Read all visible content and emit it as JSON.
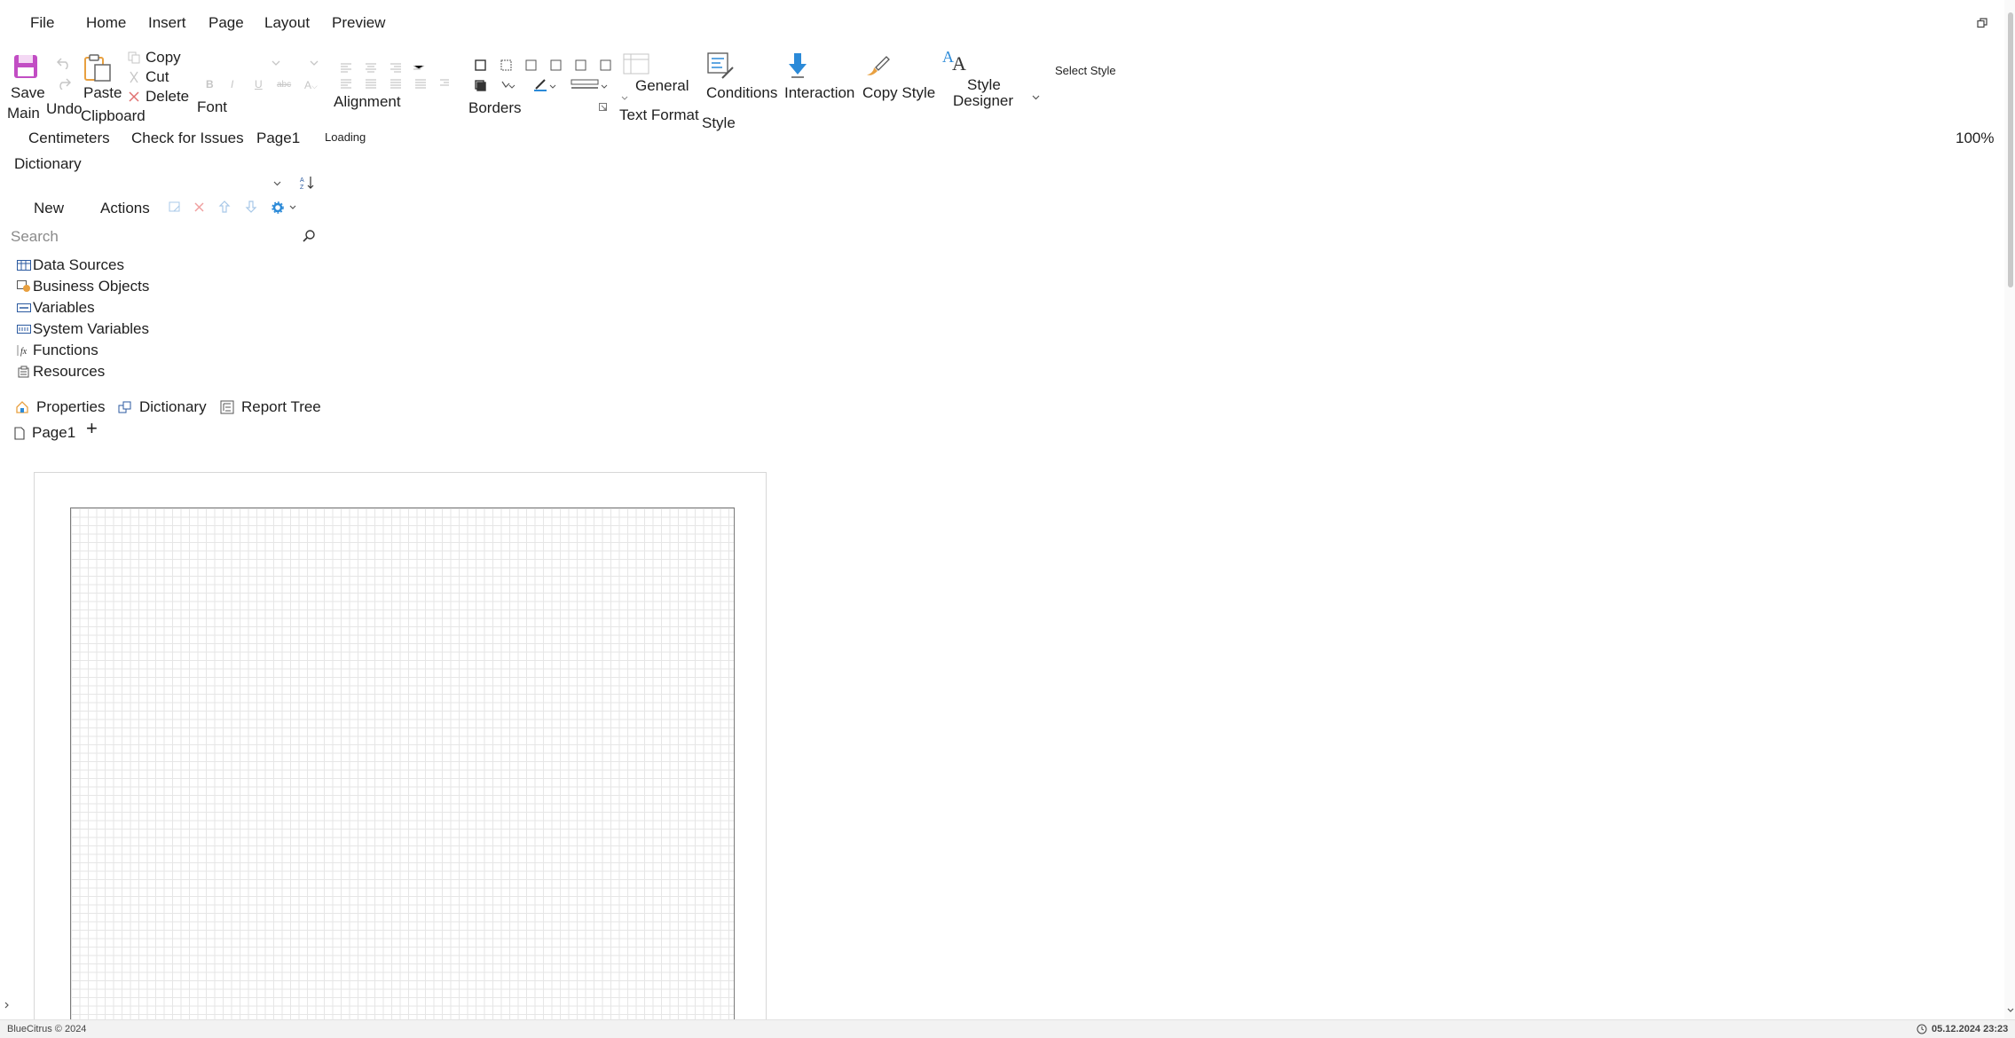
{
  "menu": {
    "file": "File",
    "home": "Home",
    "insert": "Insert",
    "page": "Page",
    "layout": "Layout",
    "preview": "Preview"
  },
  "ribbon": {
    "save_label_1": "Save",
    "save_label_2": "Main",
    "undo_label": "Undo",
    "paste_label": "Paste",
    "copy_label": "Copy",
    "cut_label": "Cut",
    "delete_label": "Delete",
    "clipboard_group": "Clipboard",
    "font_group": "Font",
    "alignment_group": "Alignment",
    "borders_group": "Borders",
    "general_label": "General",
    "text_format_group": "Text Format",
    "conditions_label": "Conditions",
    "interaction_label": "Interaction",
    "copy_style_label": "Copy Style",
    "style_designer_1": "Style",
    "style_designer_2": "Designer",
    "select_style_label": "Select Style",
    "style_group": "Style"
  },
  "subbar": {
    "units": "Centimeters",
    "check_issues": "Check for Issues",
    "page": "Page1",
    "loading": "Loading",
    "zoom": "100%"
  },
  "dictionary": {
    "title": "Dictionary",
    "new_label": "New",
    "actions_label": "Actions",
    "search_placeholder": "Search",
    "items": [
      {
        "label": "Data Sources",
        "icon": "data-sources-icon"
      },
      {
        "label": "Business Objects",
        "icon": "business-objects-icon"
      },
      {
        "label": "Variables",
        "icon": "variables-icon"
      },
      {
        "label": "System Variables",
        "icon": "system-variables-icon"
      },
      {
        "label": "Functions",
        "icon": "functions-icon"
      },
      {
        "label": "Resources",
        "icon": "resources-icon"
      }
    ]
  },
  "panel_tabs": {
    "properties": "Properties",
    "dictionary": "Dictionary",
    "report_tree": "Report Tree"
  },
  "page_tabs": {
    "page1": "Page1",
    "add": "+"
  },
  "status": {
    "copyright": "BlueCitrus © 2024",
    "datetime": "05.12.2024 23:23"
  },
  "colors": {
    "accent": "#2b8ad8",
    "save_icon": "#c24dc4",
    "delete_icon": "#e07070",
    "copy_style_icon": "#e8a040"
  }
}
